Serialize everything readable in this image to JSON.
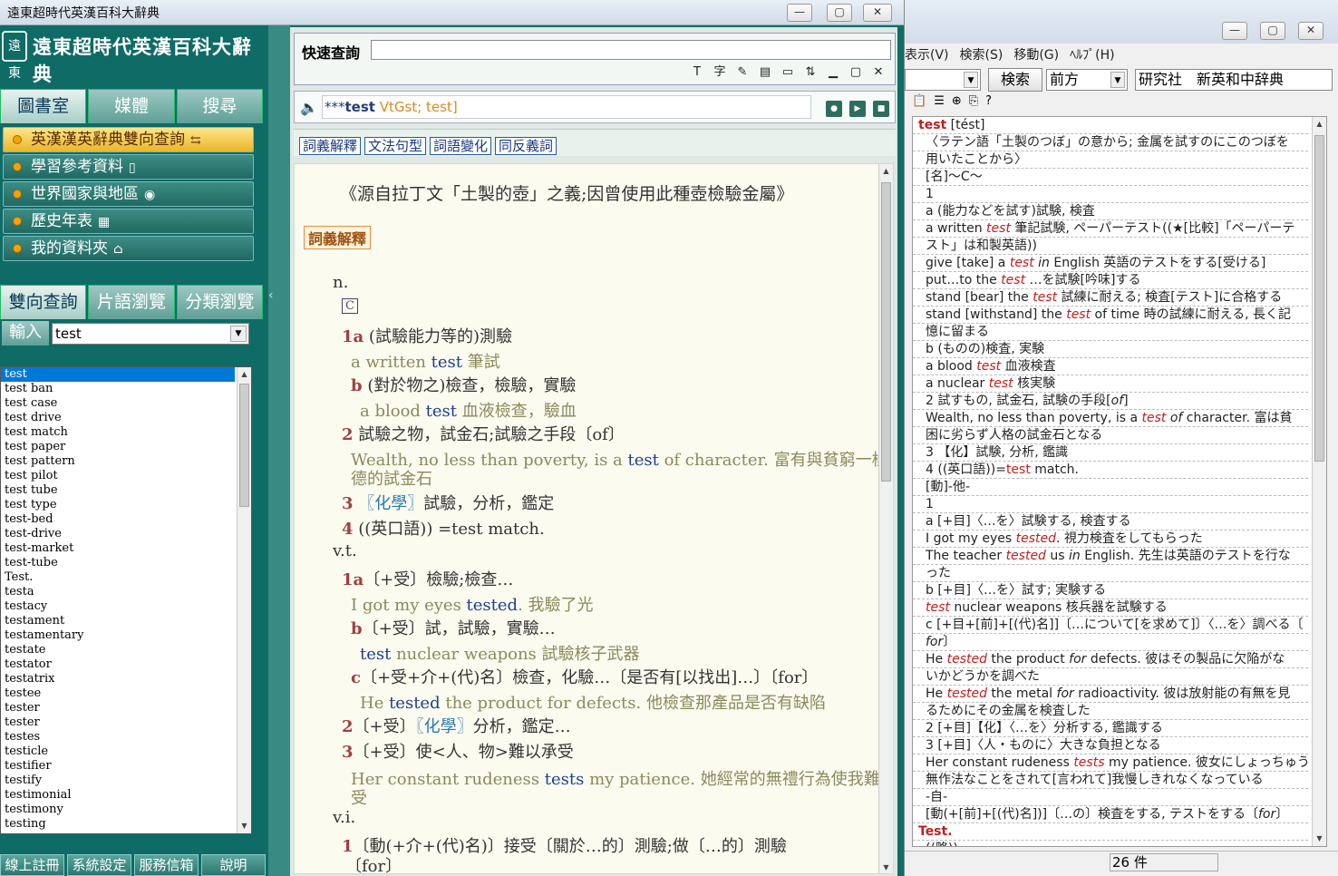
{
  "left_window": {
    "title": "遠東超時代英漢百科大辭典",
    "logo": {
      "seal": "遠東",
      "name": "遠東超時代英漢百科大辭典"
    },
    "top_tabs": [
      "圖書室",
      "媒體",
      "搜尋"
    ],
    "menu": [
      {
        "label": "英漢漢英辭典雙向查詢",
        "icon": "⇆",
        "active": true
      },
      {
        "label": "學習參考資料",
        "icon": "▯"
      },
      {
        "label": "世界國家與地區",
        "icon": "◉"
      },
      {
        "label": "歷史年表",
        "icon": "▦"
      },
      {
        "label": "我的資料夾",
        "icon": "⌂"
      }
    ],
    "search_tabs": [
      "雙向查詢",
      "片語瀏覽",
      "分類瀏覽"
    ],
    "input_label": "輸入",
    "input_value": "test",
    "word_list": [
      "test",
      "test ban",
      "test case",
      "test drive",
      "test match",
      "test paper",
      "test pattern",
      "test pilot",
      "test tube",
      "test type",
      "test-bed",
      "test-drive",
      "test-market",
      "test-tube",
      "Test.",
      "testa",
      "testacy",
      "testament",
      "testamentary",
      "testate",
      "testator",
      "testatrix",
      "testee",
      "tester",
      "tester",
      "testes",
      "testicle",
      "testifier",
      "testify",
      "testimonial",
      "testimony",
      "testing"
    ],
    "bottom_buttons": [
      "線上註冊",
      "系統設定",
      "服務信箱",
      "說明"
    ],
    "quick_label": "快速查詢",
    "toolbar_icons": [
      "T",
      "字",
      "✎",
      "▤",
      "▭",
      "⇅",
      "▁",
      "▢",
      "✕"
    ],
    "headword": {
      "stars": "***",
      "word": "test",
      "phonetic": "VtGst; test]"
    },
    "section_links": [
      "詞義解釋",
      "文法句型",
      "詞語變化",
      "同反義詞"
    ],
    "content": {
      "etymology": "《源自拉丁文「土製的壺」之義;因曾使用此種壺檢驗金屬》",
      "section_title": "詞義解釋",
      "pos_n": "n.",
      "c_mark": "C",
      "pos_vt": "v.t.",
      "pos_vi": "v.i."
    }
  },
  "right_window": {
    "menu": [
      "表示(V)",
      "検索(S)",
      "移動(G)",
      "ﾍﾙﾌﾟ(H)"
    ],
    "search_button": "検索",
    "direction": "前方",
    "dictionary": "研究社　新英和中辞典",
    "entry_count": "26 件",
    "tool_icons": [
      "📋",
      "☰",
      "⊕",
      "⎘",
      "?"
    ]
  }
}
